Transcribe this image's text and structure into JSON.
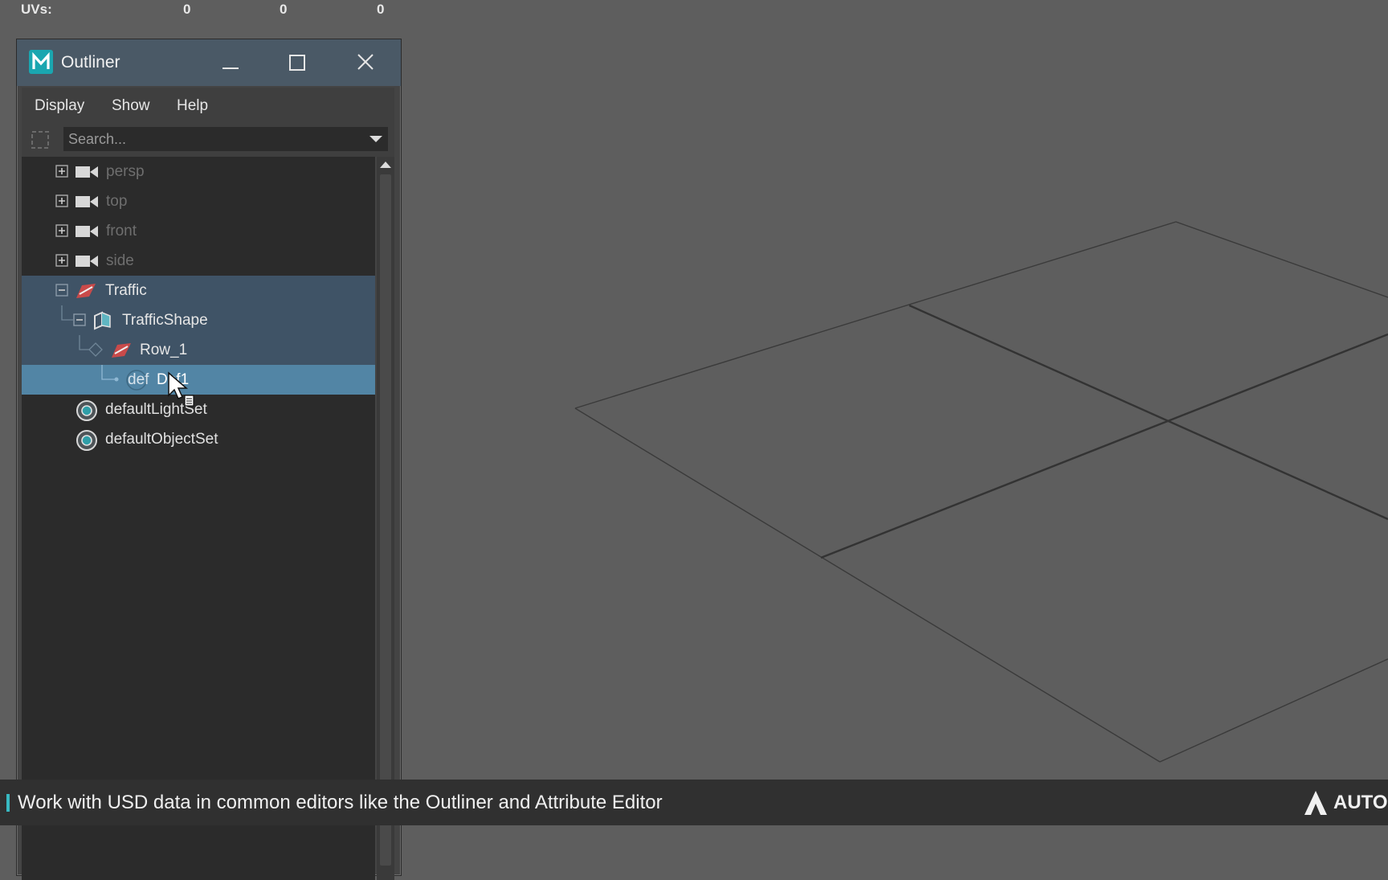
{
  "hud": {
    "label": "UVs:",
    "values": [
      "0",
      "0",
      "0"
    ]
  },
  "window": {
    "title": "Outliner",
    "app_icon": "M"
  },
  "menu": {
    "items": [
      "Display",
      "Show",
      "Help"
    ]
  },
  "search": {
    "placeholder": "Search..."
  },
  "outliner": {
    "items": [
      {
        "label": "persp",
        "icon": "camera-icon"
      },
      {
        "label": "top",
        "icon": "camera-icon"
      },
      {
        "label": "front",
        "icon": "camera-icon"
      },
      {
        "label": "side",
        "icon": "camera-icon"
      },
      {
        "label": "Traffic",
        "icon": "transform-icon"
      },
      {
        "label": "TrafficShape",
        "icon": "shape-icon"
      },
      {
        "label": "Row_1",
        "icon": "transform-icon"
      },
      {
        "label": "Def1",
        "prefix": "def",
        "icon": "def-icon"
      },
      {
        "label": "defaultLightSet",
        "icon": "set-icon"
      },
      {
        "label": "defaultObjectSet",
        "icon": "set-icon"
      }
    ]
  },
  "caption": {
    "text": "Work with USD data in common editors like the Outliner and Attribute Editor",
    "brand": "AUTODESK"
  },
  "colors": {
    "accent": "#38b9c2",
    "selection": "#5285a5",
    "selection_soft": "#3f5366"
  }
}
